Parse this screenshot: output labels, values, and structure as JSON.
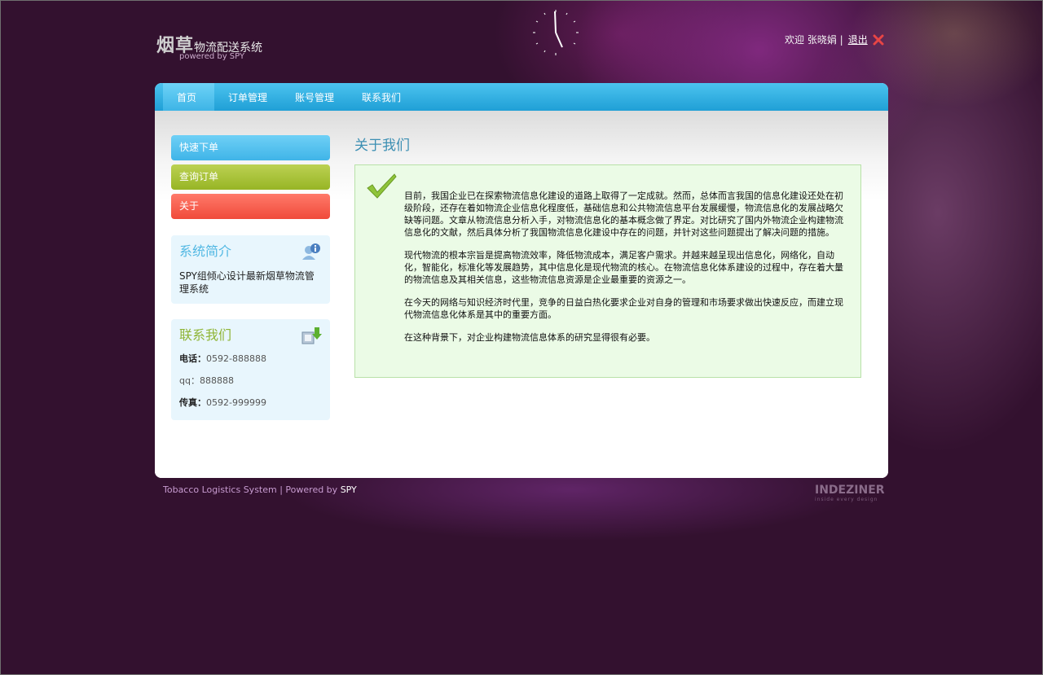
{
  "header": {
    "logo_main": "烟草",
    "logo_rest": "物流配送系统",
    "logo_sub": "powered by SPY",
    "welcome": "欢迎 张晓娟 |",
    "logout": "退出"
  },
  "nav": [
    {
      "label": "首页",
      "active": true
    },
    {
      "label": "订单管理",
      "active": false
    },
    {
      "label": "账号管理",
      "active": false
    },
    {
      "label": "联系我们",
      "active": false
    }
  ],
  "sidebar": {
    "menu": [
      {
        "label": "快速下单"
      },
      {
        "label": "查询订单"
      },
      {
        "label": "关于"
      }
    ],
    "intro": {
      "title": "系统简介",
      "text": "SPY组倾心设计最新烟草物流管理系统"
    },
    "contact": {
      "title": "联系我们",
      "phone_label": "电话：",
      "phone": "0592-888888",
      "qq_label": "qq：",
      "qq": "888888",
      "fax_label": "传真：",
      "fax": "0592-999999"
    }
  },
  "main": {
    "title": "关于我们",
    "paragraphs": [
      "目前，我国企业已在探索物流信息化建设的道路上取得了一定成就。然而，总体而言我国的信息化建设还处在初级阶段，还存在着如物流企业信息化程度低，基础信息和公共物流信息平台发展缓慢，物流信息化的发展战略欠缺等问题。文章从物流信息分析入手，对物流信息化的基本概念做了界定。对比研究了国内外物流企业构建物流信息化的文献，然后具体分析了我国物流信息化建设中存在的问题，并针对这些问题提出了解决问题的措施。",
      "现代物流的根本宗旨是提高物流效率，降低物流成本，满足客户需求。并越来越呈现出信息化，网络化，自动化，智能化，标准化等发展趋势，其中信息化是现代物流的核心。在物流信息化体系建设的过程中，存在着大量的物流信息及其相关信息，这些物流信息资源是企业最重要的资源之一。",
      "在今天的网络与知识经济时代里，竞争的日益白热化要求企业对自身的管理和市场要求做出快速反应，而建立现代物流信息化体系是其中的重要方面。",
      "在这种背景下，对企业构建物流信息体系的研究显得很有必要。"
    ]
  },
  "footer": {
    "text": "Tobacco Logistics System | Powered by ",
    "spy": "SPY",
    "brand": "INDEZINER",
    "brand_sub": "inside every design"
  },
  "colors": {
    "nav_blue": "#1f9fd6",
    "menu_blue": "#3fb4e8",
    "menu_green": "#97b525",
    "menu_red": "#f04a3a",
    "content_bg": "#ebfbe6"
  }
}
